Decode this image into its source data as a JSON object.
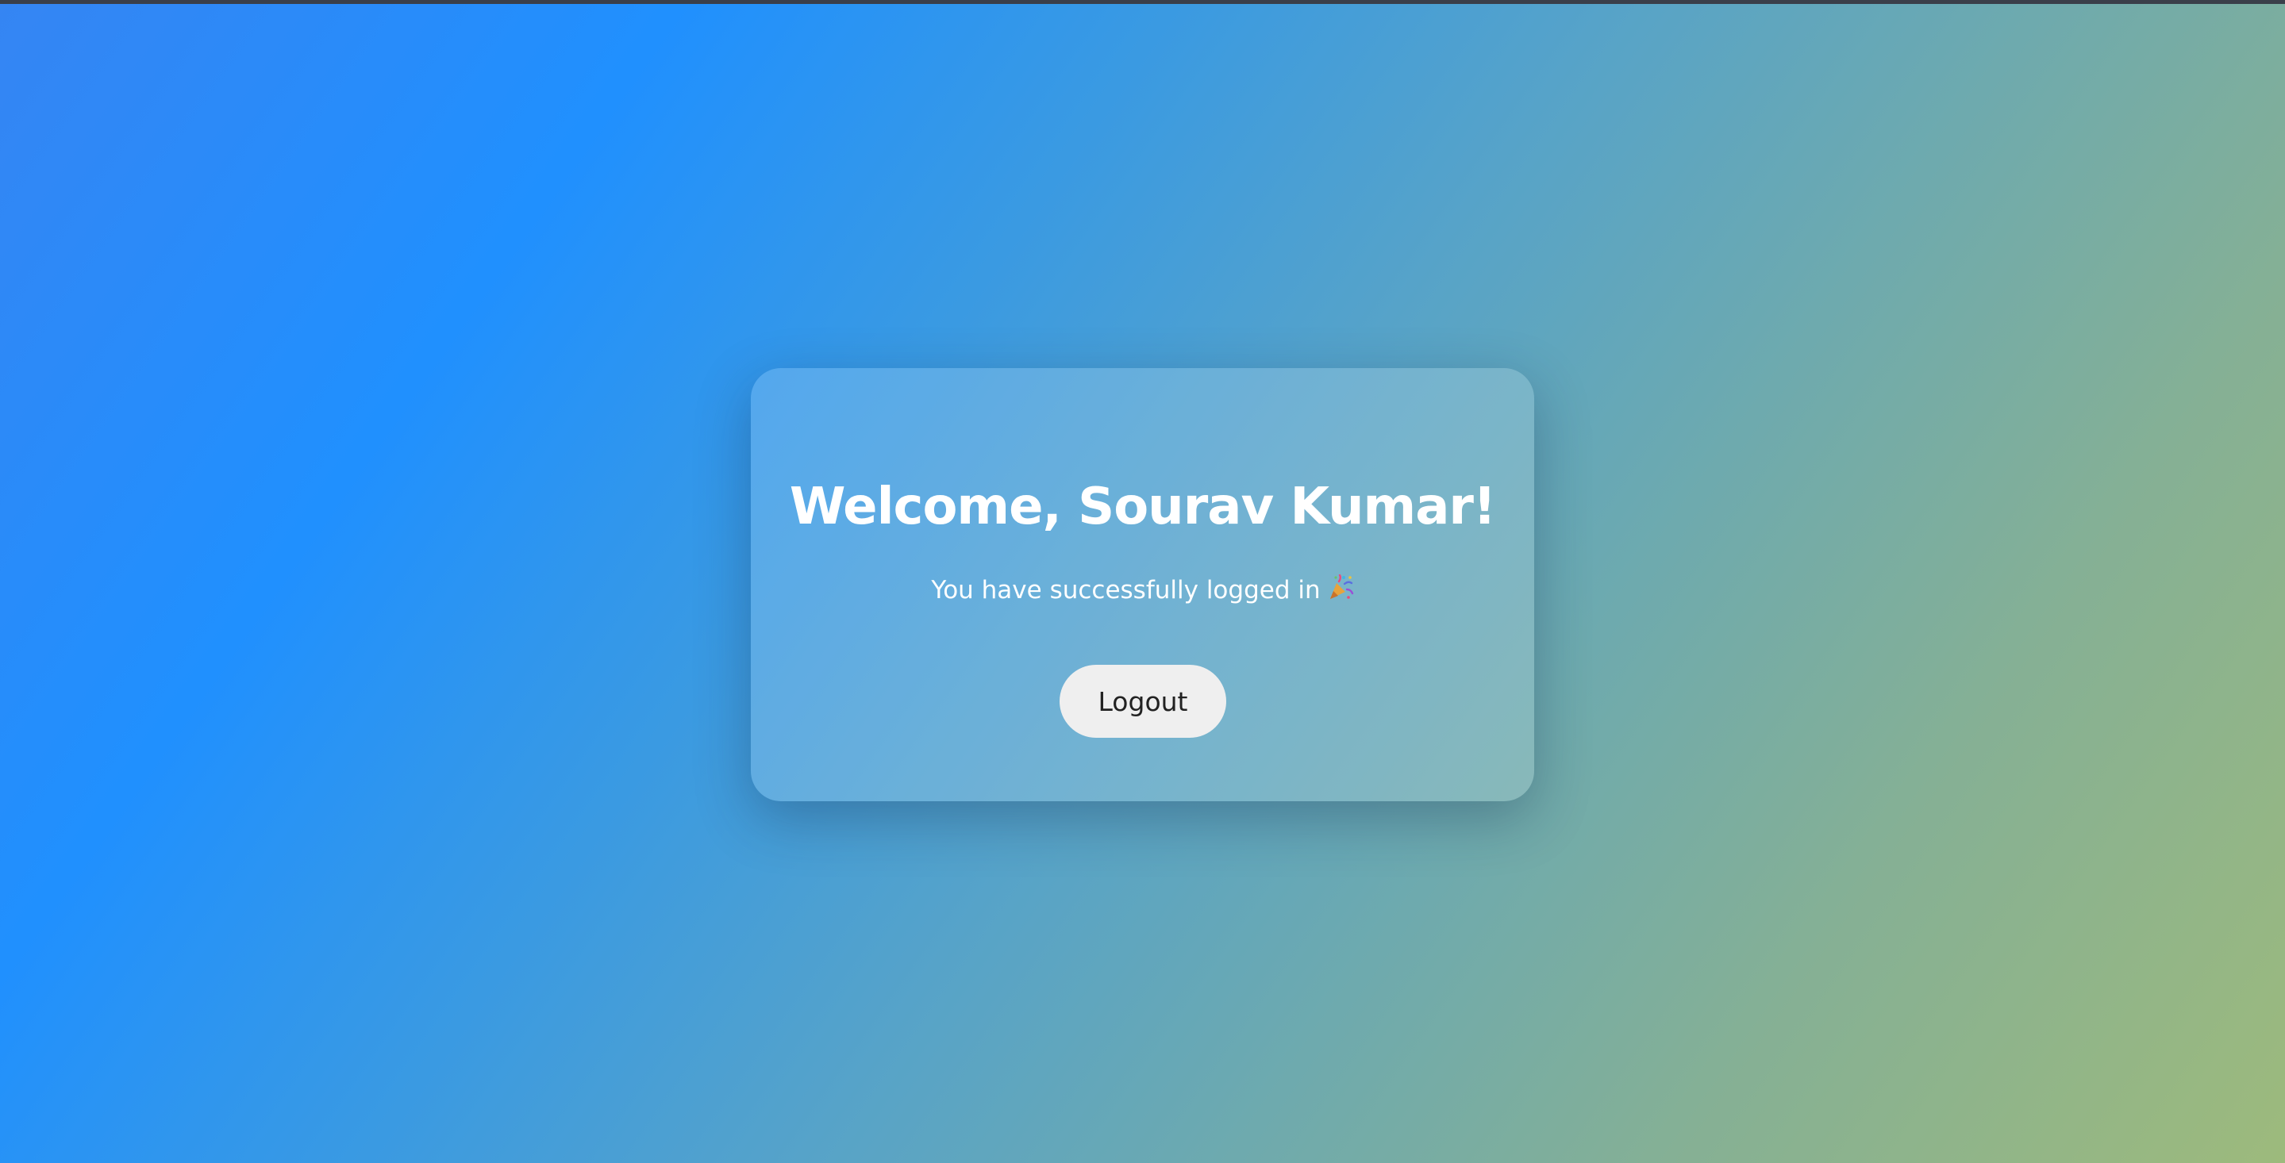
{
  "welcome": {
    "title": "Welcome, Sourav Kumar!",
    "message": "You have successfully logged in",
    "emoji_icon": "party-popper-icon",
    "logout_label": "Logout"
  },
  "colors": {
    "gradient_start": "#3585f3",
    "gradient_mid": "#56a3c9",
    "gradient_end": "#9dba7c",
    "card_text": "#ffffff",
    "button_bg": "#efefef",
    "button_text": "#222222"
  }
}
